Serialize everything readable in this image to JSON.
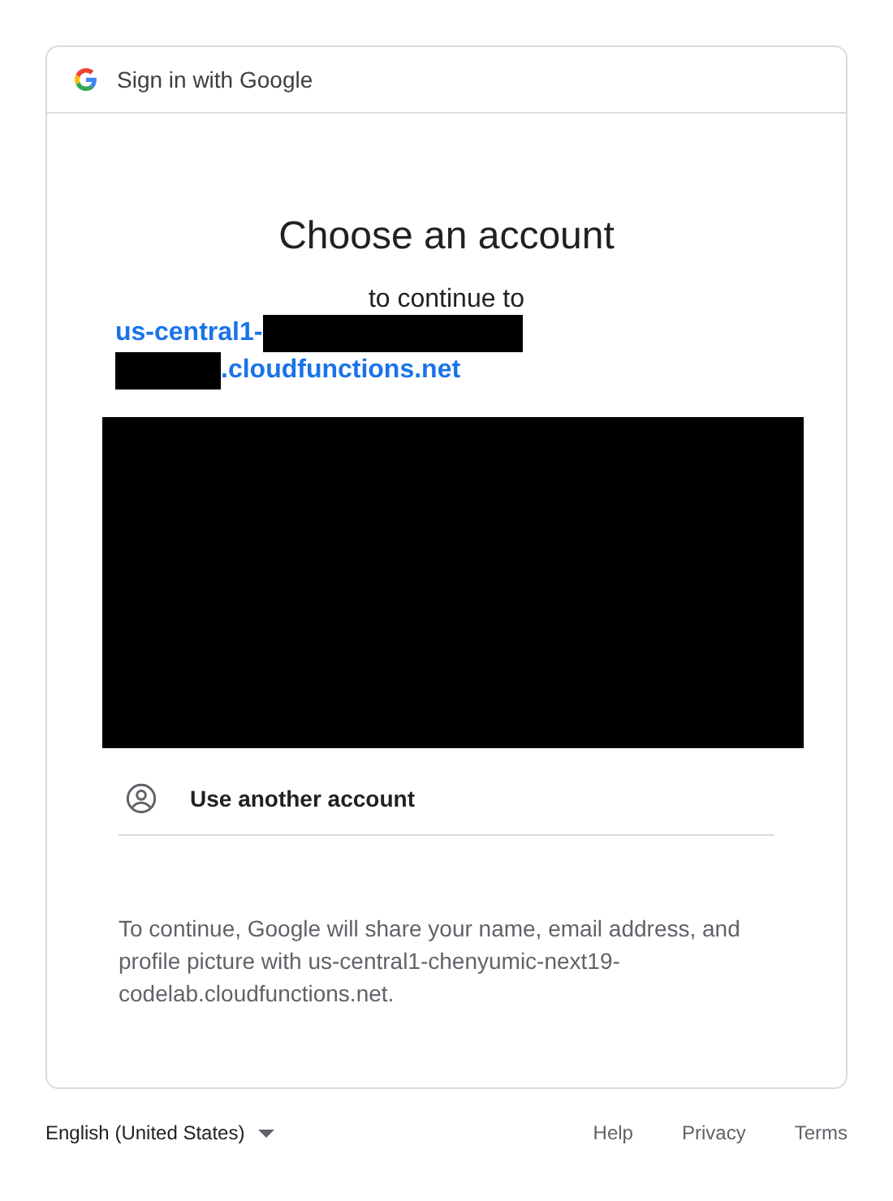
{
  "header": {
    "title": "Sign in with Google"
  },
  "heading": "Choose an account",
  "subheading": "to continue to",
  "app_link": [
    {
      "kind": "text",
      "text": "us-central1-"
    },
    {
      "kind": "redacted_wide"
    },
    {
      "kind": "break"
    },
    {
      "kind": "redacted_narrow"
    },
    {
      "kind": "text",
      "text": ".cloudfunctions.net"
    }
  ],
  "accounts": {
    "kind": "redacted"
  },
  "other_account": {
    "label": "Use another account"
  },
  "consent": "To continue, Google will share your name, email address, and profile picture with us-central1-chenyumic-next19-codelab.cloudfunctions.net.",
  "footer": {
    "language": "English (United States)",
    "links": [
      "Help",
      "Privacy",
      "Terms"
    ]
  }
}
